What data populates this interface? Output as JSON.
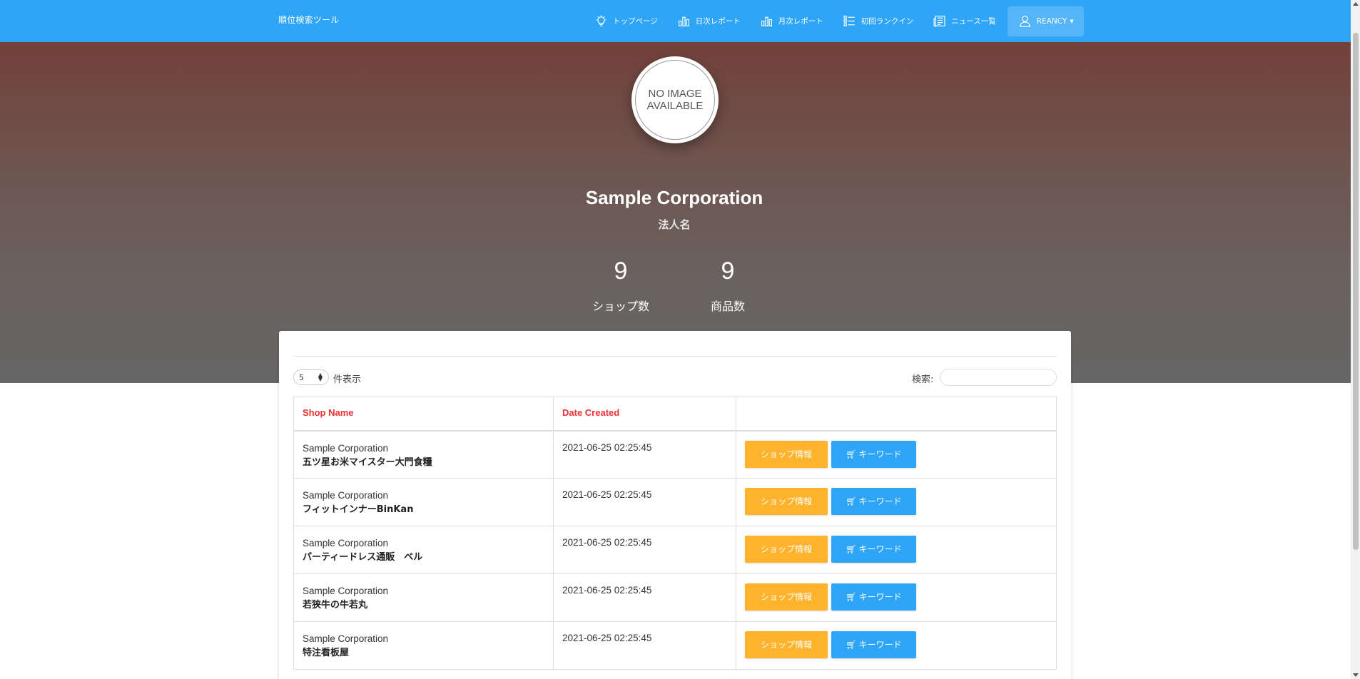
{
  "navbar": {
    "brand": "順位検索ツール",
    "items": [
      {
        "icon": "lightbulb-icon",
        "label": "トップページ"
      },
      {
        "icon": "bar-chart-icon",
        "label": "日次レポート"
      },
      {
        "icon": "bar-chart-icon",
        "label": "月次レポート"
      },
      {
        "icon": "list-icon",
        "label": "初回ランクイン"
      },
      {
        "icon": "news-icon",
        "label": "ニュース一覧"
      }
    ],
    "user": {
      "icon": "user-icon",
      "label": "REANCY"
    }
  },
  "profile": {
    "image_line1": "NO IMAGE",
    "image_line2": "AVAILABLE",
    "name": "Sample Corporation",
    "subtitle": "法人名",
    "stats": [
      {
        "value": "9",
        "label": "ショップ数"
      },
      {
        "value": "9",
        "label": "商品数"
      }
    ]
  },
  "table_controls": {
    "page_length": "5",
    "page_length_suffix": "件表示",
    "search_label": "検索:",
    "search_value": ""
  },
  "table": {
    "headers": [
      "Shop Name",
      "Date Created",
      ""
    ],
    "rows": [
      {
        "company": "Sample Corporation",
        "shop": "五ツ星お米マイスター大門食糧",
        "date": "2021-06-25 02:25:45"
      },
      {
        "company": "Sample Corporation",
        "shop": "フィットインナーBinKan",
        "date": "2021-06-25 02:25:45"
      },
      {
        "company": "Sample Corporation",
        "shop": "パーティードレス通販　ベル",
        "date": "2021-06-25 02:25:45"
      },
      {
        "company": "Sample Corporation",
        "shop": "若狭牛の牛若丸",
        "date": "2021-06-25 02:25:45"
      },
      {
        "company": "Sample Corporation",
        "shop": "特注看板屋",
        "date": "2021-06-25 02:25:45"
      }
    ],
    "actions": {
      "shop_info": "ショップ情報",
      "keyword": "キーワード"
    }
  },
  "colors": {
    "primary": "#2fa5f8",
    "warning": "#ffb22b",
    "header_text": "#ee3333"
  }
}
